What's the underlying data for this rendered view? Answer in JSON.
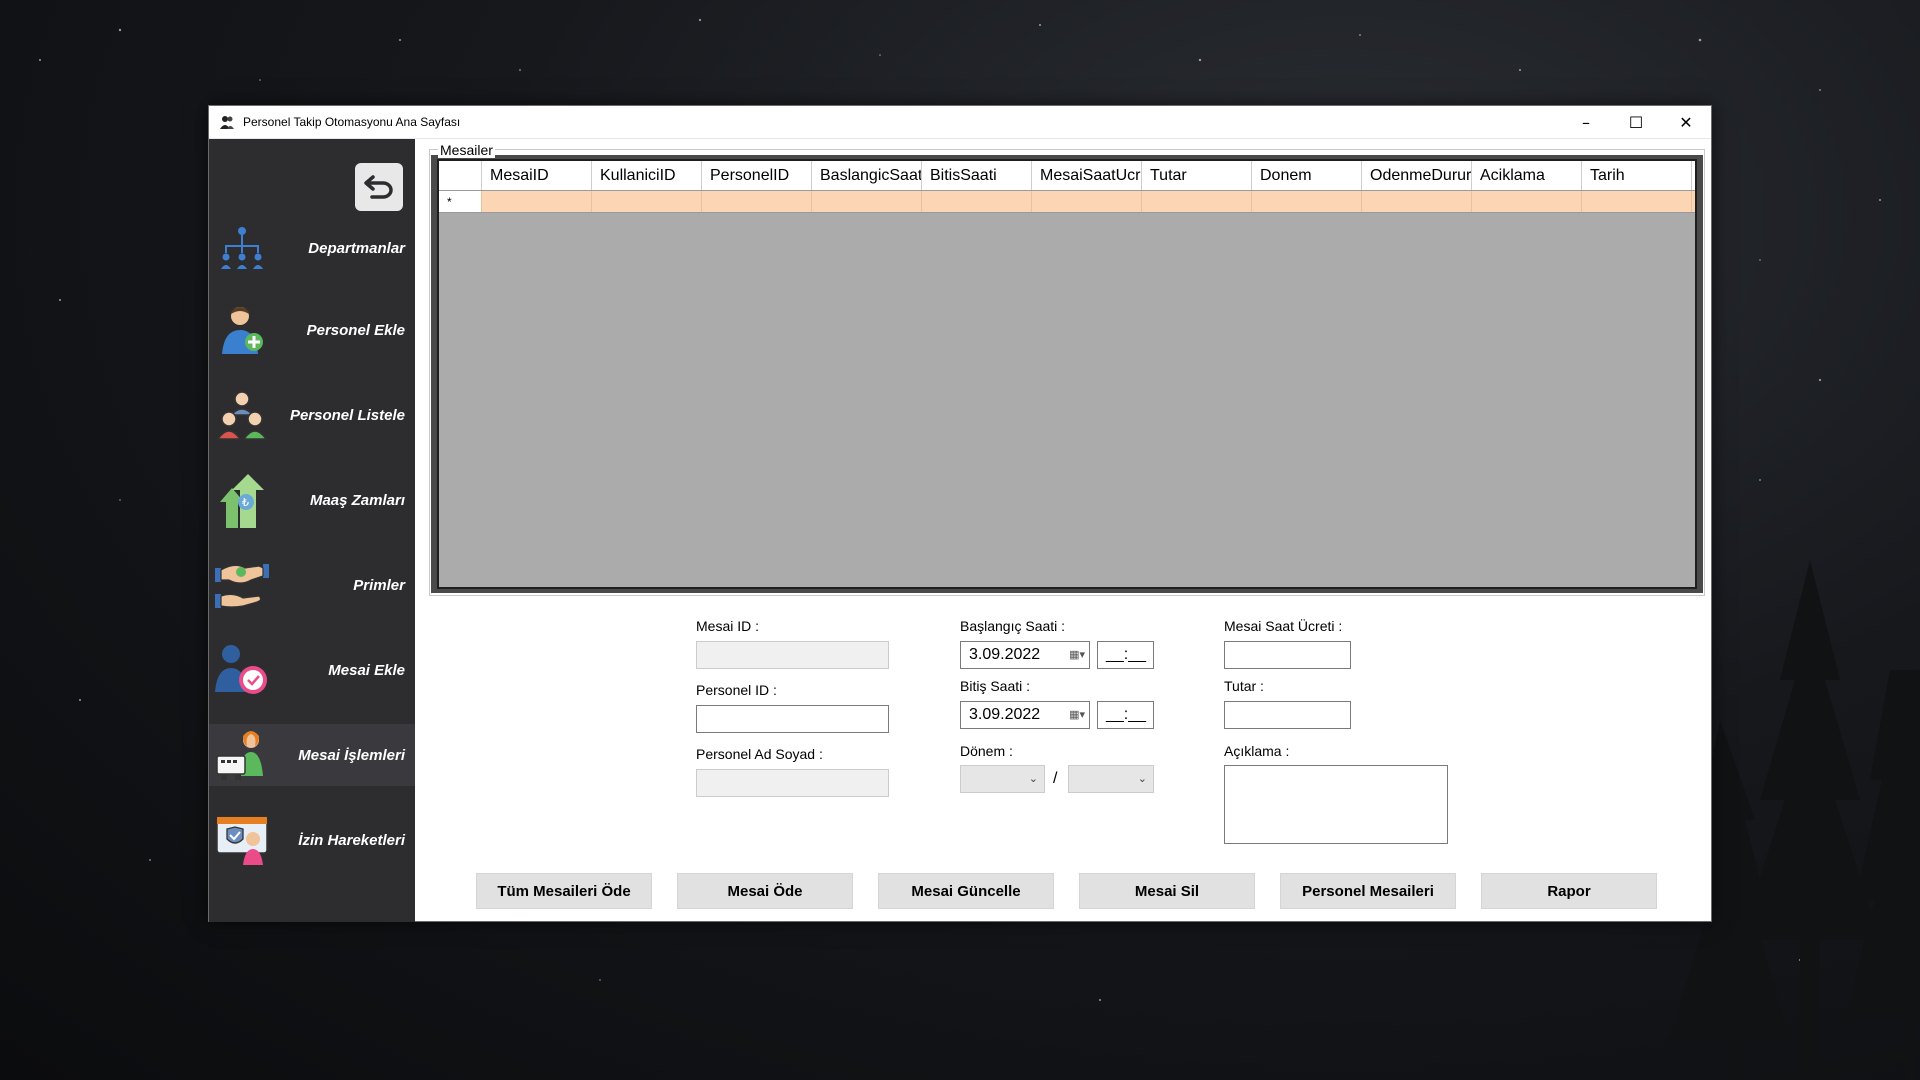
{
  "window": {
    "title": "Personel Takip Otomasyonu Ana Sayfası"
  },
  "sidebar": {
    "items": [
      {
        "label": "Departmanlar",
        "icon": "org-chart-icon"
      },
      {
        "label": "Personel Ekle",
        "icon": "add-person-icon"
      },
      {
        "label": "Personel Listele",
        "icon": "people-group-icon"
      },
      {
        "label": "Maaş Zamları",
        "icon": "salary-raise-icon"
      },
      {
        "label": "Primler",
        "icon": "bonus-handshake-icon"
      },
      {
        "label": "Mesai Ekle",
        "icon": "add-overtime-icon"
      },
      {
        "label": "Mesai İşlemleri",
        "icon": "overtime-operations-icon"
      },
      {
        "label": "İzin Hareketleri",
        "icon": "leave-movements-icon"
      }
    ],
    "active_index": 6
  },
  "groupbox": {
    "title": "Mesailer"
  },
  "grid": {
    "columns": [
      "MesaiID",
      "KullaniciID",
      "PersonelID",
      "BaslangicSaat",
      "BitisSaati",
      "MesaiSaatUcr",
      "Tutar",
      "Donem",
      "OdenmeDurur",
      "Aciklama",
      "Tarih"
    ],
    "new_row_marker": "*"
  },
  "form": {
    "mesai_id_label": "Mesai ID :",
    "personel_id_label": "Personel ID :",
    "personel_ad_soyad_label": "Personel Ad Soyad :",
    "baslangic_label": "Başlangıç Saati :",
    "baslangic_date": "3.09.2022",
    "baslangic_time": "__:__",
    "bitis_label": "Bitiş Saati :",
    "bitis_date": "3.09.2022",
    "bitis_time": "__:__",
    "donem_label": "Dönem :",
    "donem_separator": "/",
    "mesai_saat_ucreti_label": "Mesai Saat Ücreti :",
    "tutar_label": "Tutar :",
    "aciklama_label": "Açıklama :"
  },
  "buttons": {
    "tum_mesaileri_ode": "Tüm Mesaileri Öde",
    "mesai_ode": "Mesai Öde",
    "mesai_guncelle": "Mesai Güncelle",
    "mesai_sil": "Mesai Sil",
    "personel_mesaileri": "Personel Mesaileri",
    "rapor": "Rapor"
  }
}
